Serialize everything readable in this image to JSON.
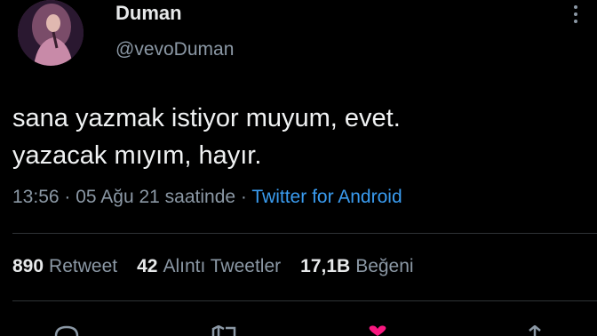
{
  "user": {
    "display_name": "Duman",
    "handle": "@vevoDuman"
  },
  "tweet": {
    "line1": "sana yazmak istiyor muyum, evet.",
    "line2": "yazacak mıyım, hayır.",
    "time": "13:56",
    "separator": "·",
    "date": "05 Ağu 21 saatinde",
    "source": "Twitter for Android"
  },
  "stats": {
    "retweets_count": "890",
    "retweets_label": "Retweet",
    "quotes_count": "42",
    "quotes_label": "Alıntı Tweetler",
    "likes_count": "17,1B",
    "likes_label": "Beğeni"
  },
  "icons": {
    "more": "more-vertical-icon",
    "reply": "reply-icon",
    "retweet": "retweet-icon",
    "like": "heart-icon",
    "share": "share-icon"
  },
  "colors": {
    "background": "#000000",
    "text": "#e7e9ea",
    "secondary": "#8b98a5",
    "link": "#3a9cf0",
    "like": "#f91880"
  }
}
